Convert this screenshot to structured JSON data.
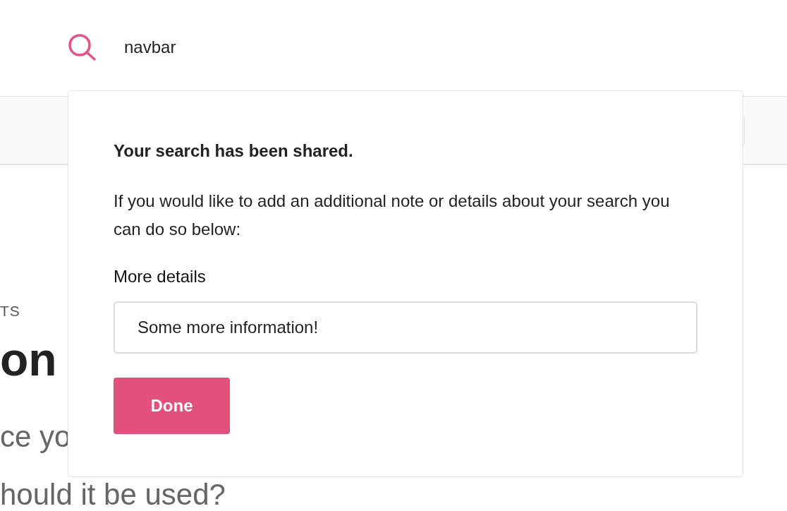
{
  "search": {
    "value": "navbar"
  },
  "background": {
    "label": "TS",
    "heading": "on",
    "lines": [
      "ce yo",
      "hould it be used?"
    ]
  },
  "dialog": {
    "title": "Your search has been shared.",
    "message": "If you would like to add an additional note or details about your search you can do so below:",
    "field_label": "More details",
    "field_value": "Some more information!",
    "button": "Done"
  }
}
